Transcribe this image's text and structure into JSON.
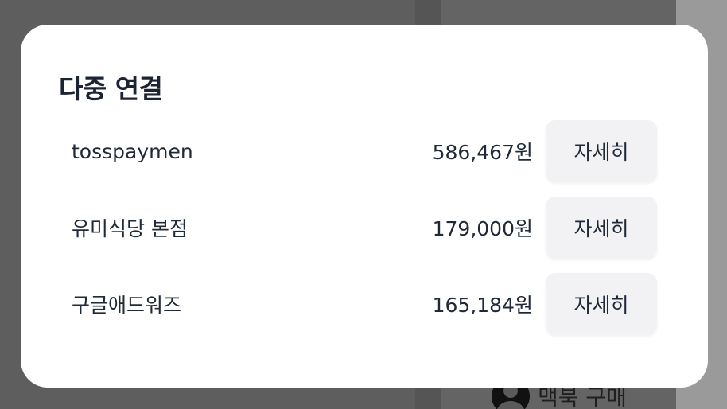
{
  "background": {
    "user_label": "맥북 구매"
  },
  "modal": {
    "title": "다중 연결",
    "rows": [
      {
        "merchant": "tosspaymen",
        "amount": "586,467원",
        "button": "자세히"
      },
      {
        "merchant": "유미식당 본점",
        "amount": "179,000원",
        "button": "자세히"
      },
      {
        "merchant": "구글애드워즈",
        "amount": "165,184원",
        "button": "자세히"
      }
    ]
  }
}
